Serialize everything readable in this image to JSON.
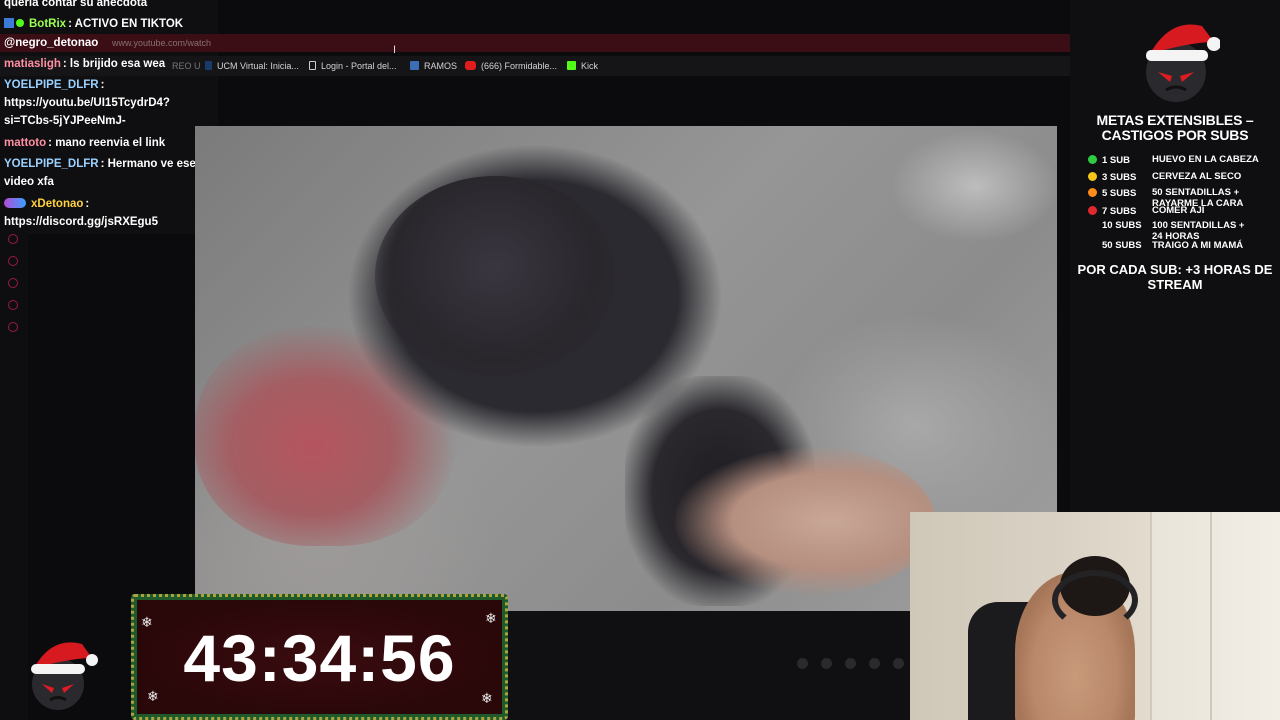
{
  "browser": {
    "url": "www.youtube.com/watch",
    "bookmarks": [
      {
        "label": "REO U",
        "icon": "bookmark-icon",
        "color": "#444"
      },
      {
        "label": "UCM Virtual: Inicia...",
        "icon": "ucm-icon",
        "color": "#1a3a6b"
      },
      {
        "label": "Login - Portal del...",
        "icon": "page-icon",
        "color": "#555"
      },
      {
        "label": "RAMOS",
        "icon": "ramos-icon",
        "color": "#3b6fb5"
      },
      {
        "label": "(666) Formidable...",
        "icon": "youtube-icon",
        "color": "#e11c1c"
      },
      {
        "label": "Kick",
        "icon": "kick-icon",
        "color": "#53fc18"
      }
    ]
  },
  "chat": [
    {
      "user": "",
      "text": "queria contar su anecdota",
      "color": "#ffffff"
    },
    {
      "user": "BotRix",
      "text": ": ACTIVO EN TIKTOK",
      "color": "#9cff52",
      "badges": [
        "bot-badge",
        "verified-badge"
      ]
    },
    {
      "user": "@negro_detonao",
      "text": "",
      "color": "#ffffff"
    },
    {
      "user": "matiasligh",
      "text": ": ls brijido esa wea",
      "color": "#ff8fa3"
    },
    {
      "user": "YOELPIPE_DLFR",
      "text": ":",
      "color": "#9ad1ff"
    },
    {
      "user": "",
      "text": "https://youtu.be/UI15TcydrD4?",
      "color": "#ffffff"
    },
    {
      "user": "",
      "text": "si=TCbs-5jYJPeeNmJ-",
      "color": "#ffffff"
    },
    {
      "user": "mattoto",
      "text": ": mano reenvia el link",
      "color": "#ff8fa3"
    },
    {
      "user": "YOELPIPE_DLFR",
      "text": ": Hermano ve ese",
      "color": "#9ad1ff"
    },
    {
      "user": "",
      "text": "video xfa",
      "color": "#ffffff"
    },
    {
      "user": "xDetonao",
      "text": ":",
      "color": "#ffd23f",
      "badges": [
        "sub-badge"
      ]
    },
    {
      "user": "",
      "text": "https://discord.gg/jsRXEgu5",
      "color": "#ffffff"
    }
  ],
  "metas": {
    "title": "METAS EXTENSIBLES – CASTIGOS POR SUBS",
    "goals": [
      {
        "subs": "1 SUB",
        "text": "HUEVO EN LA CABEZA",
        "color": "#2ecc40"
      },
      {
        "subs": "3 SUBS",
        "text": "CERVEZA AL SECO",
        "color": "#f5c518"
      },
      {
        "subs": "5 SUBS",
        "text": "50 SENTADILLAS + RAYARME LA CARA",
        "color": "#ff8c1a"
      },
      {
        "subs": "7 SUBS",
        "text": "COMER AJI",
        "color": "#e0282e"
      },
      {
        "subs": "10 SUBS",
        "text": "100 SENTADILLAS + 24 HORAS",
        "color": ""
      },
      {
        "subs": "50 SUBS",
        "text": "TRAIGO A MI MAMÁ",
        "color": ""
      }
    ],
    "per_sub": "POR CADA SUB: +3 HORAS DE STREAM"
  },
  "timer": {
    "value": "43:34:56"
  }
}
